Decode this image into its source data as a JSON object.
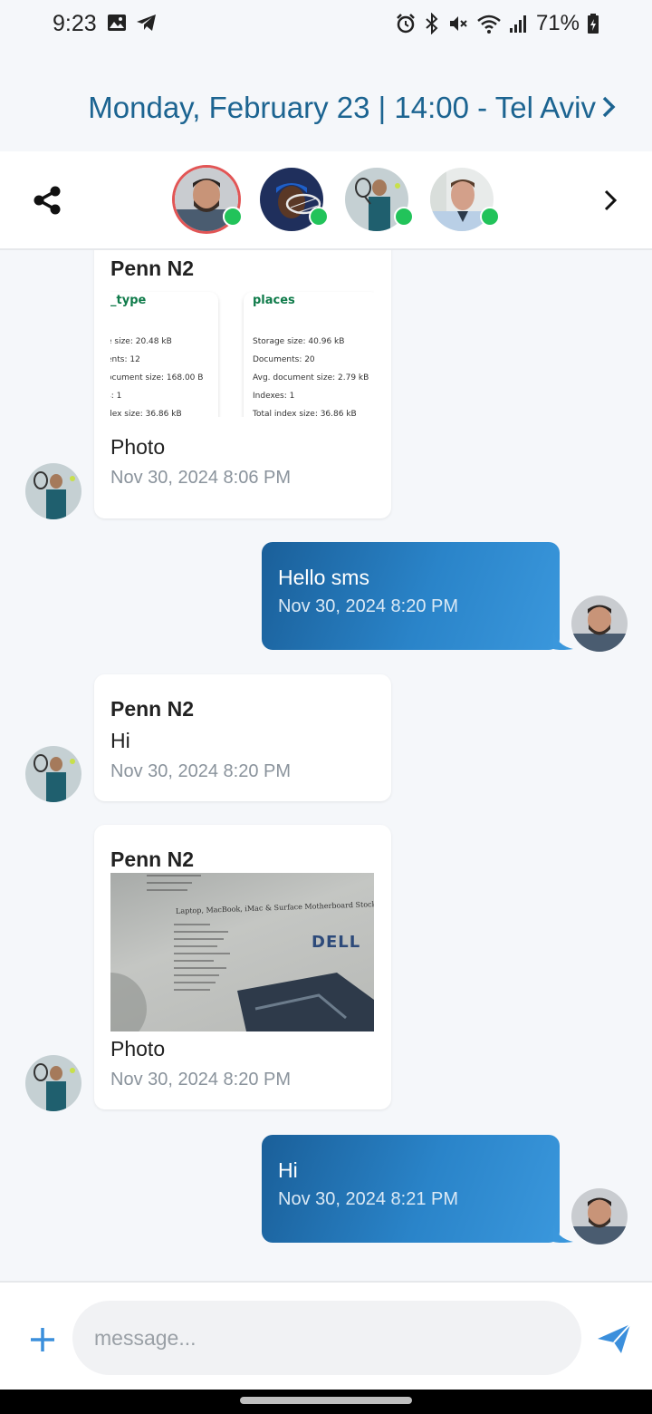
{
  "status_bar": {
    "time": "9:23",
    "battery_percent": "71%"
  },
  "header": {
    "title": "Monday, February 23 | 14:00 - Tel Aviv"
  },
  "composer": {
    "placeholder": "message..."
  },
  "messages": [
    {
      "sender": "Penn N2",
      "text": "Photo",
      "time": "Nov 30, 2024 8:06 PM",
      "attachment": {
        "left_header": "_type",
        "left_rows": [
          "e size: 20.48 kB",
          "ents: 12",
          "ocument size: 168.00 B",
          "s: 1",
          "dex size: 36.86 kB"
        ],
        "right_header": "places",
        "right_rows": [
          "Storage size: 40.96 kB",
          "Documents: 20",
          "Avg. document size: 2.79 kB",
          "Indexes: 1",
          "Total index size: 36.86 kB"
        ]
      }
    },
    {
      "text": "Hello sms",
      "time": "Nov 30, 2024 8:20 PM"
    },
    {
      "sender": "Penn N2",
      "text": "Hi",
      "time": "Nov 30, 2024 8:20 PM"
    },
    {
      "sender": "Penn N2",
      "text": "Photo",
      "time": "Nov 30, 2024 8:20 PM",
      "photo_brand": "DELL",
      "photo_heading": "Laptop, MacBook, iMac & Surface Motherboard Stock"
    },
    {
      "text": "Hi",
      "time": "Nov 30, 2024 8:21 PM"
    }
  ],
  "colors": {
    "accent": "#1c6491",
    "online": "#22c35a",
    "selected_ring": "#e25555",
    "send": "#3b8fdc"
  }
}
